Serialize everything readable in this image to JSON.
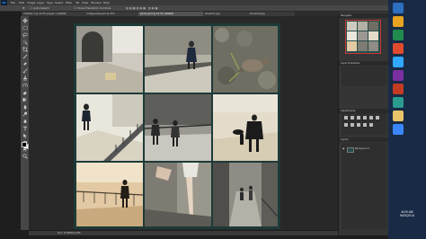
{
  "app": {
    "logo": "Ps",
    "menu": [
      "File",
      "Edit",
      "Image",
      "Layer",
      "Type",
      "Select",
      "Filter",
      "3D",
      "View",
      "Window",
      "Help"
    ]
  },
  "options_bar": {
    "auto_select_label": "Auto-Select:",
    "transform_controls_label": "Show Transform Controls"
  },
  "document_tabs": [
    {
      "label": "Untitled-1 @ 12.5% (Layer 1, RGB/8)",
      "active": false
    },
    {
      "label": "collage-base.psd @ 25%",
      "active": false
    },
    {
      "label": "photo-grid @ 33.3% (RGB/8)",
      "active": true
    },
    {
      "label": "street-01.jpg",
      "active": false
    },
    {
      "label": "street-02.jpg",
      "active": false
    }
  ],
  "status": {
    "zoom": "Doc: 8.58M/12.0M"
  },
  "panels": {
    "navigator_title": "Navigator",
    "properties_title": "Layer Properties",
    "adjustments_title": "Adjustments",
    "layers_title": "Layers",
    "layers": [
      {
        "name": "Background"
      }
    ]
  },
  "photos": [
    "arched-gateway-street",
    "woman-walking-street",
    "pigeon-on-cobblestones",
    "person-on-walkway",
    "couple-walking-promenade",
    "man-with-dog-beach",
    "pier-people-waterfront",
    "legs-holding-bag",
    "children-walking-alley"
  ],
  "taskbar": {
    "time": "8:09 AM",
    "date": "9/05/2014"
  },
  "colors": {
    "document_bg": "#1d3a38",
    "ps_blue": "#31a8ff",
    "taskbar": "#192a45"
  }
}
